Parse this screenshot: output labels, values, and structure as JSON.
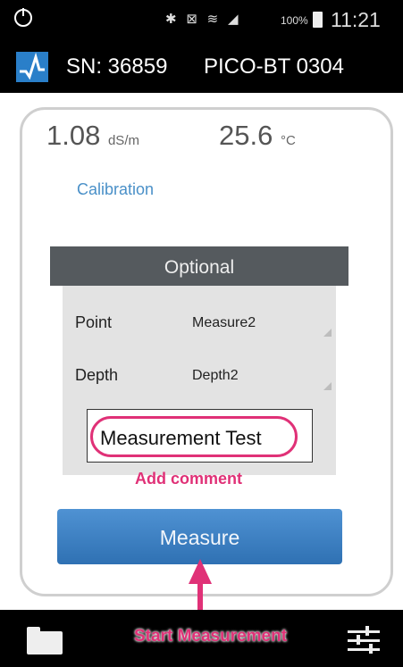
{
  "status_bar": {
    "left_icon": "power-icon",
    "icons": "bluetooth-icon mute-icon wifi-icon signal-icon",
    "icons_glyphs": "✱ ⊠ ≋ ◢",
    "battery": "100%",
    "time": "11:21"
  },
  "app_bar": {
    "logo_icon": "pulse-logo-icon",
    "serial": "SN: 36859",
    "device": "PICO-BT 0304"
  },
  "readings": {
    "ec_value": "1.08",
    "ec_unit": "dS/m",
    "temp_value": "25.6",
    "temp_unit": "°C"
  },
  "calibration_link": "Calibration",
  "optional": {
    "title": "Optional",
    "point_label": "Point",
    "point_value": "Measure2",
    "depth_label": "Depth",
    "depth_value": "Depth2",
    "comment_value": "Measurement Test"
  },
  "annotations": {
    "add_comment": "Add comment",
    "start_measurement": "Start Measurement",
    "accent_color": "#e03177"
  },
  "measure_button": "Measure",
  "bottom_bar": {
    "left_icon": "folder-icon",
    "right_icon": "settings-sliders-icon"
  },
  "colors": {
    "primary": "#2f71b3",
    "link": "#4a90c8",
    "header": "#555a5e"
  }
}
